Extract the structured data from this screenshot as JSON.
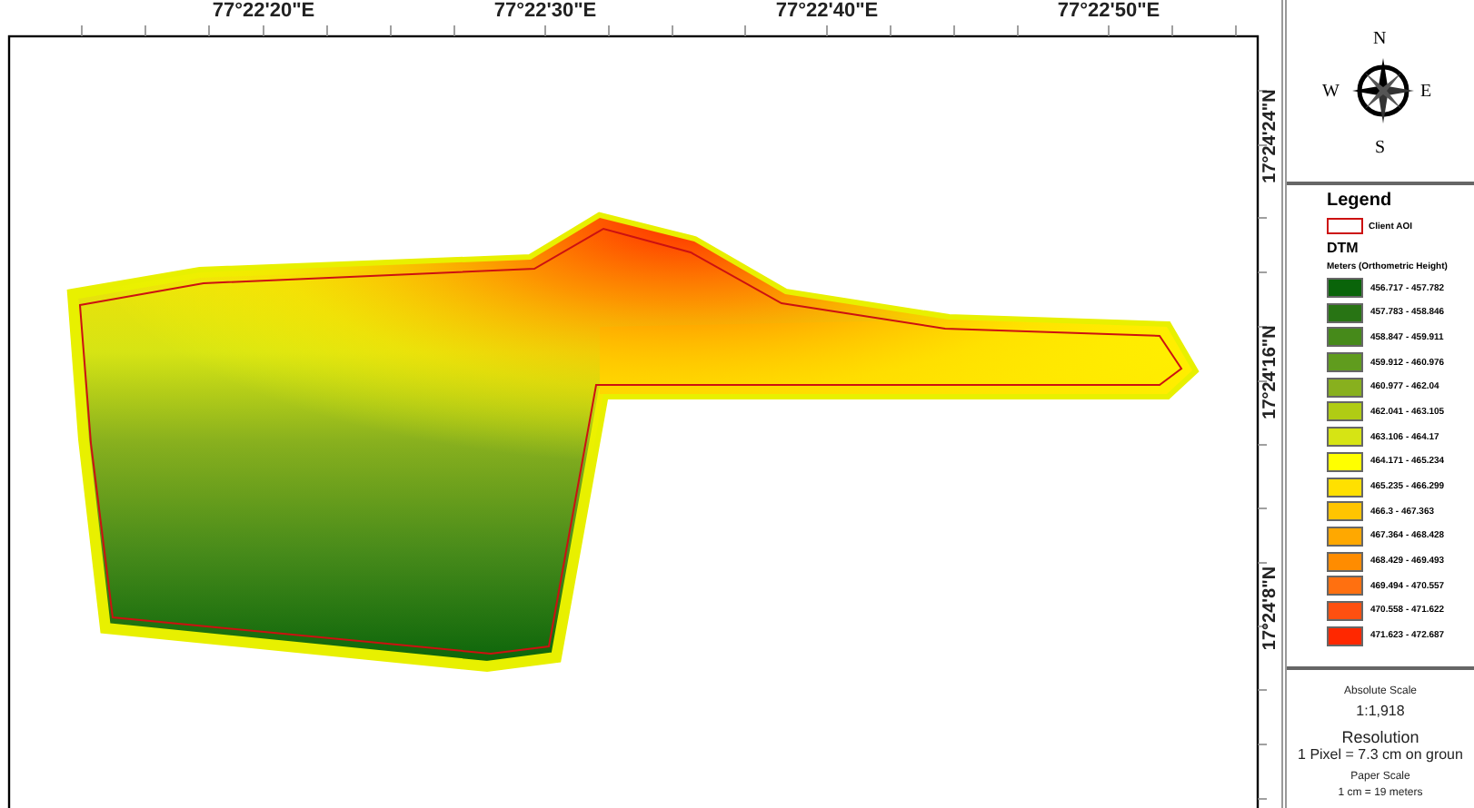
{
  "map": {
    "top_labels": [
      "77°22'20\"E",
      "77°22'30\"E",
      "77°22'40\"E",
      "77°22'50\"E"
    ],
    "right_labels": [
      "17°24'24\"N",
      "17°24'16\"N",
      "17°24'8\"N"
    ]
  },
  "compass": {
    "north": "N",
    "east": "E",
    "south": "S",
    "west": "W"
  },
  "legend": {
    "title": "Legend",
    "boundary": {
      "label": "Client AOI",
      "color": "#cc1111"
    },
    "layer": "DTM",
    "unit": "Meters (Orthometric Height)",
    "classes": [
      {
        "label": "456.717 - 457.782",
        "color": "#0a640a"
      },
      {
        "label": "457.783 - 458.846",
        "color": "#287414"
      },
      {
        "label": "458.847 - 459.911",
        "color": "#468a1a"
      },
      {
        "label": "459.912 - 460.976",
        "color": "#609c1e"
      },
      {
        "label": "460.977 - 462.04",
        "color": "#88b01e"
      },
      {
        "label": "462.041 - 463.105",
        "color": "#b0cc14"
      },
      {
        "label": "463.106 - 464.17",
        "color": "#d6e414"
      },
      {
        "label": "464.171 - 465.234",
        "color": "#ffff00"
      },
      {
        "label": "465.235 - 466.299",
        "color": "#ffe000"
      },
      {
        "label": "466.3 - 467.363",
        "color": "#ffc400"
      },
      {
        "label": "467.364 - 468.428",
        "color": "#ffa800"
      },
      {
        "label": "468.429 - 469.493",
        "color": "#ff8c00"
      },
      {
        "label": "469.494 - 470.557",
        "color": "#ff7010"
      },
      {
        "label": "470.558 - 471.622",
        "color": "#ff5010"
      },
      {
        "label": "471.623 - 472.687",
        "color": "#ff2800"
      }
    ]
  },
  "scale": {
    "absolute_label": "Absolute Scale",
    "absolute_value": "1:1,918",
    "resolution_label": "Resolution",
    "resolution_value": "1 Pixel = 7.3 cm on groun",
    "paper_label": "Paper Scale",
    "paper_value": "1 cm = 19 meters"
  }
}
